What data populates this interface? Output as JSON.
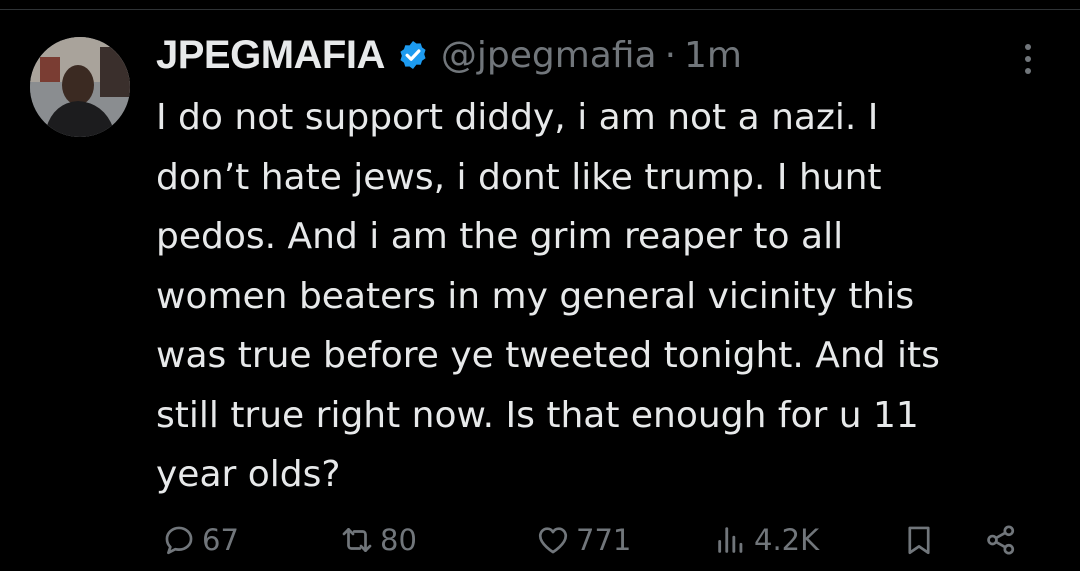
{
  "tweet": {
    "display_name": "JPEGMAFIA",
    "handle": "@jpegmafia",
    "separator": "·",
    "time": "1m",
    "verified": true,
    "text_lines": [
      "I do not support diddy, i am not a nazi. I",
      "don’t hate jews, i dont like trump. I hunt",
      "pedos. And i am the grim reaper to all",
      "women beaters in my general vicinity this",
      "was true before ye tweeted tonight. And its",
      "still true right now. Is that enough for u 11",
      "year olds?"
    ]
  },
  "actions": {
    "replies": "67",
    "retweets": "80",
    "likes": "771",
    "views": "4.2K"
  },
  "icons": {
    "verified": "verified-badge-icon",
    "more": "more-vertical-icon",
    "reply": "reply-icon",
    "retweet": "retweet-icon",
    "like": "heart-icon",
    "views": "views-chart-icon",
    "bookmark": "bookmark-icon",
    "share": "share-icon"
  },
  "colors": {
    "background": "#000000",
    "text": "#e7e9ea",
    "muted": "#71767b",
    "verified": "#1d9bf0"
  }
}
